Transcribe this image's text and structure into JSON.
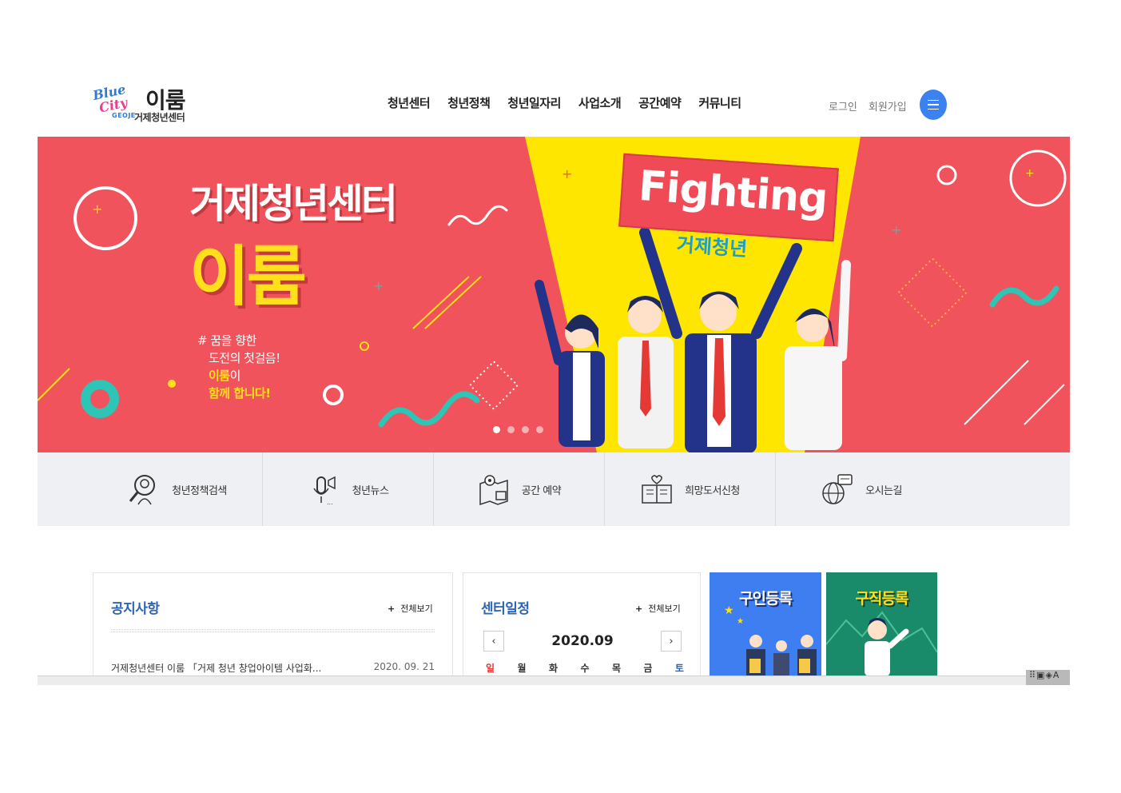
{
  "header": {
    "logo_blue": "Blue",
    "logo_city": "City",
    "logo_geoje": "GEOJE",
    "logo_main": "이룸",
    "logo_sub": "거제청년센터",
    "nav": [
      {
        "label": "청년센터"
      },
      {
        "label": "청년정책"
      },
      {
        "label": "청년일자리"
      },
      {
        "label": "사업소개"
      },
      {
        "label": "공간예약"
      },
      {
        "label": "커뮤니티"
      }
    ],
    "login": "로그인",
    "signup": "회원가입"
  },
  "banner": {
    "title": "거제청년센터",
    "subtitle": "이룸",
    "tag_line1": "# 꿈을 향한",
    "tag_line2": "도전의 첫걸음!",
    "tag_line3_em": "이룸",
    "tag_line3_rest": "이",
    "tag_line4": "함께 합니다!",
    "sign_text": "Fighting",
    "sign_sub": "거제청년",
    "colors": {
      "bg": "#f0535b",
      "beam": "#ffe600",
      "accent": "#2ec4b6"
    }
  },
  "quick_menu": [
    {
      "label": "청년정책검색",
      "icon": "magnifier-person-icon"
    },
    {
      "label": "청년뉴스",
      "icon": "microphone-icon"
    },
    {
      "label": "공간 예약",
      "icon": "map-pin-icon"
    },
    {
      "label": "희망도서신청",
      "icon": "book-heart-icon"
    },
    {
      "label": "오시는길",
      "icon": "globe-chat-icon"
    }
  ],
  "notice": {
    "title": "공지사항",
    "more": "전체보기",
    "items": [
      {
        "text": "거제청년센터 이룸 「거제 청년 창업아이템 사업화...",
        "date": "2020. 09. 21"
      }
    ]
  },
  "schedule": {
    "title": "센터일정",
    "more": "전체보기",
    "month": "2020.09",
    "weekdays": [
      "일",
      "월",
      "화",
      "수",
      "목",
      "금",
      "토"
    ]
  },
  "promos": {
    "hire": "구인등록",
    "job": "구직등록"
  }
}
